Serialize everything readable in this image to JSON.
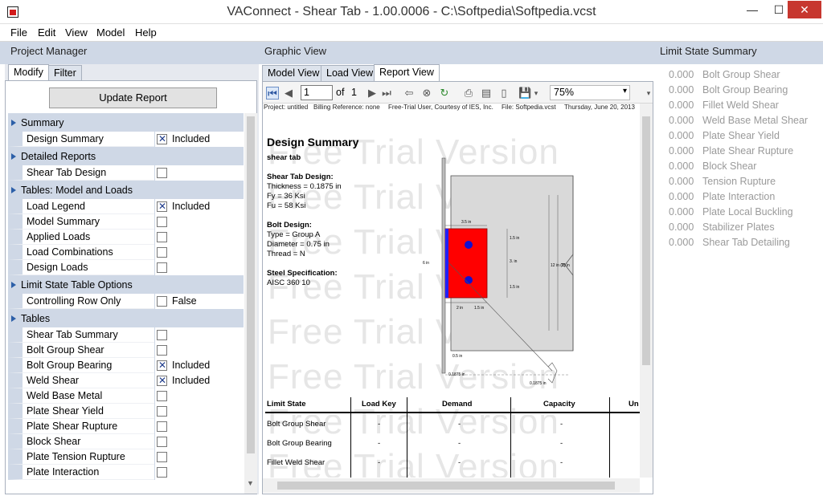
{
  "window": {
    "title": "VAConnect - Shear Tab - 1.00.0006 - C:\\Softpedia\\Softpedia.vcst"
  },
  "menu": [
    "File",
    "Edit",
    "View",
    "Model",
    "Help"
  ],
  "panels": {
    "project_manager": "Project Manager",
    "graphic_view": "Graphic View",
    "limit_state_summary": "Limit State Summary"
  },
  "left_tabs": [
    "Modify",
    "Filter"
  ],
  "update_button": "Update Report",
  "categories": [
    {
      "name": "Summary",
      "rows": [
        {
          "label": "Design Summary",
          "checked": true,
          "value": "Included"
        }
      ]
    },
    {
      "name": "Detailed Reports",
      "rows": [
        {
          "label": "Shear Tab Design",
          "checked": false,
          "value": ""
        }
      ]
    },
    {
      "name": "Tables: Model and Loads",
      "rows": [
        {
          "label": "Load Legend",
          "checked": true,
          "value": "Included"
        },
        {
          "label": "Model Summary",
          "checked": false,
          "value": ""
        },
        {
          "label": "Applied Loads",
          "checked": false,
          "value": ""
        },
        {
          "label": "Load Combinations",
          "checked": false,
          "value": ""
        },
        {
          "label": "Design Loads",
          "checked": false,
          "value": ""
        }
      ]
    },
    {
      "name": "Limit State Table Options",
      "rows": [
        {
          "label": "Controlling Row Only",
          "checked": false,
          "value": "False"
        }
      ]
    },
    {
      "name": "Tables",
      "rows": [
        {
          "label": "Shear Tab Summary",
          "checked": false,
          "value": ""
        },
        {
          "label": "Bolt Group Shear",
          "checked": false,
          "value": ""
        },
        {
          "label": "Bolt Group Bearing",
          "checked": true,
          "value": "Included"
        },
        {
          "label": "Weld Shear",
          "checked": true,
          "value": "Included"
        },
        {
          "label": "Weld Base Metal",
          "checked": false,
          "value": ""
        },
        {
          "label": "Plate Shear Yield",
          "checked": false,
          "value": ""
        },
        {
          "label": "Plate Shear Rupture",
          "checked": false,
          "value": ""
        },
        {
          "label": "Block Shear",
          "checked": false,
          "value": ""
        },
        {
          "label": "Plate Tension Rupture",
          "checked": false,
          "value": ""
        },
        {
          "label": "Plate Interaction",
          "checked": false,
          "value": ""
        }
      ]
    }
  ],
  "graphic_tabs": [
    "Model View",
    "Load View",
    "Report View"
  ],
  "toolbar": {
    "page": "1",
    "of": "of",
    "total": "1",
    "zoom": "75%"
  },
  "report": {
    "info": {
      "project": "Project: untitled",
      "billing": "Billing Reference: none",
      "user": "Free-Trial User, Courtesy of IES, Inc.",
      "file": "File: Softpedia.vcst",
      "date": "Thursday, June 20, 2013"
    },
    "watermark": "Free Trial Version",
    "title": "Design Summary",
    "subtitle": "shear tab",
    "shear_tab_design": {
      "heading": "Shear Tab Design:",
      "thickness": "Thickness = 0.1875 in",
      "fy": "Fy = 36 Ksi",
      "fu": "Fu = 58 Ksi"
    },
    "bolt_design": {
      "heading": "Bolt Design:",
      "type": "Type = Group A",
      "diameter": "Diameter = 0.75 in",
      "thread": "Thread = N"
    },
    "steel": {
      "heading": "Steel Specification:",
      "value": "AISC 360 10"
    },
    "drawing_dims": {
      "top": "3.5 in",
      "d1": "1.5 in",
      "d2": "3. in",
      "d3": "1.5 in",
      "left": "6 in",
      "r1": "12 in (T)",
      "r2": "15 in",
      "b1": "2 in",
      "b2": "1.5 in",
      "b3": "0.5 in",
      "b4": "0.1875 in",
      "b5": "0.1875 in"
    },
    "table": {
      "headers": [
        "Limit State",
        "Load Key",
        "Demand",
        "Capacity",
        "Un"
      ],
      "rows": [
        [
          "Bolt Group Shear",
          "-",
          "-",
          "-"
        ],
        [
          "Bolt Group Bearing",
          "-",
          "-",
          "-"
        ],
        [
          "Fillet Weld Shear",
          "-",
          "-",
          "-"
        ]
      ]
    }
  },
  "limit_states": [
    {
      "value": "0.000",
      "name": "Bolt Group Shear"
    },
    {
      "value": "0.000",
      "name": "Bolt Group Bearing"
    },
    {
      "value": "0.000",
      "name": "Fillet Weld Shear"
    },
    {
      "value": "0.000",
      "name": "Weld Base Metal Shear"
    },
    {
      "value": "0.000",
      "name": "Plate Shear Yield"
    },
    {
      "value": "0.000",
      "name": "Plate Shear Rupture"
    },
    {
      "value": "0.000",
      "name": "Block Shear"
    },
    {
      "value": "0.000",
      "name": "Tension Rupture"
    },
    {
      "value": "0.000",
      "name": "Plate Interaction"
    },
    {
      "value": "0.000",
      "name": "Plate Local Buckling"
    },
    {
      "value": "0.000",
      "name": "Stabilizer Plates"
    },
    {
      "value": "0.000",
      "name": "Shear Tab Detailing"
    }
  ]
}
